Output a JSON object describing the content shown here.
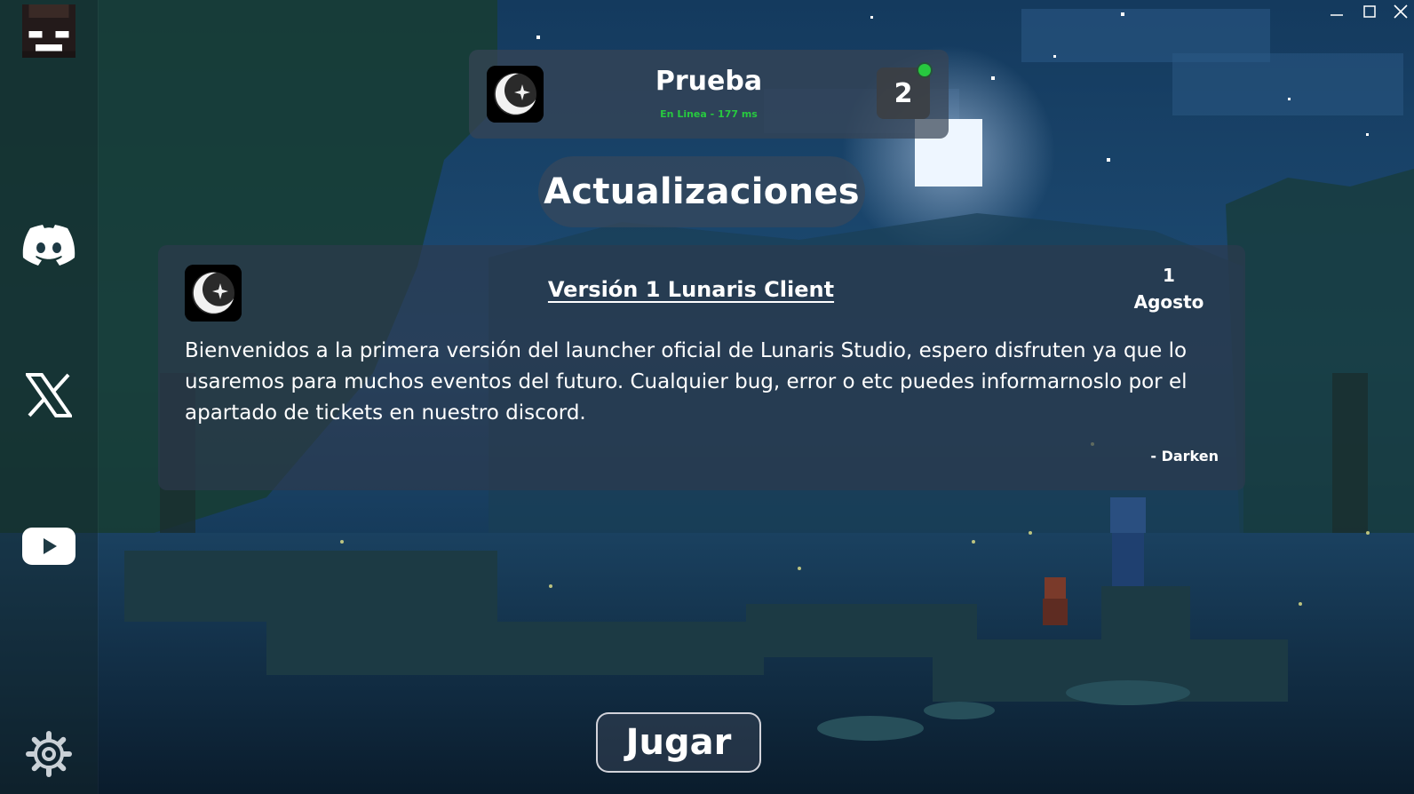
{
  "server": {
    "name": "Prueba",
    "status": "En Linea - 177 ms",
    "players": "2"
  },
  "section_title": "Actualizaciones",
  "news": {
    "title": "Versión 1 Lunaris Client",
    "day": "1",
    "month": "Agosto",
    "body": "Bienvenidos a la primera versión del launcher oficial de Lunaris Studio, espero disfruten ya que lo usaremos para muchos eventos del futuro. Cualquier bug, error o etc puedes informarnoslo por el apartado de tickets en nuestro discord.",
    "author": "- Darken"
  },
  "play_button": "Jugar",
  "sidebar": {
    "icons": [
      "avatar",
      "discord-icon",
      "x-icon",
      "youtube-icon",
      "gear-icon"
    ]
  },
  "colors": {
    "online": "#27c93f",
    "panel": "#374455",
    "text": "#ffffff"
  }
}
